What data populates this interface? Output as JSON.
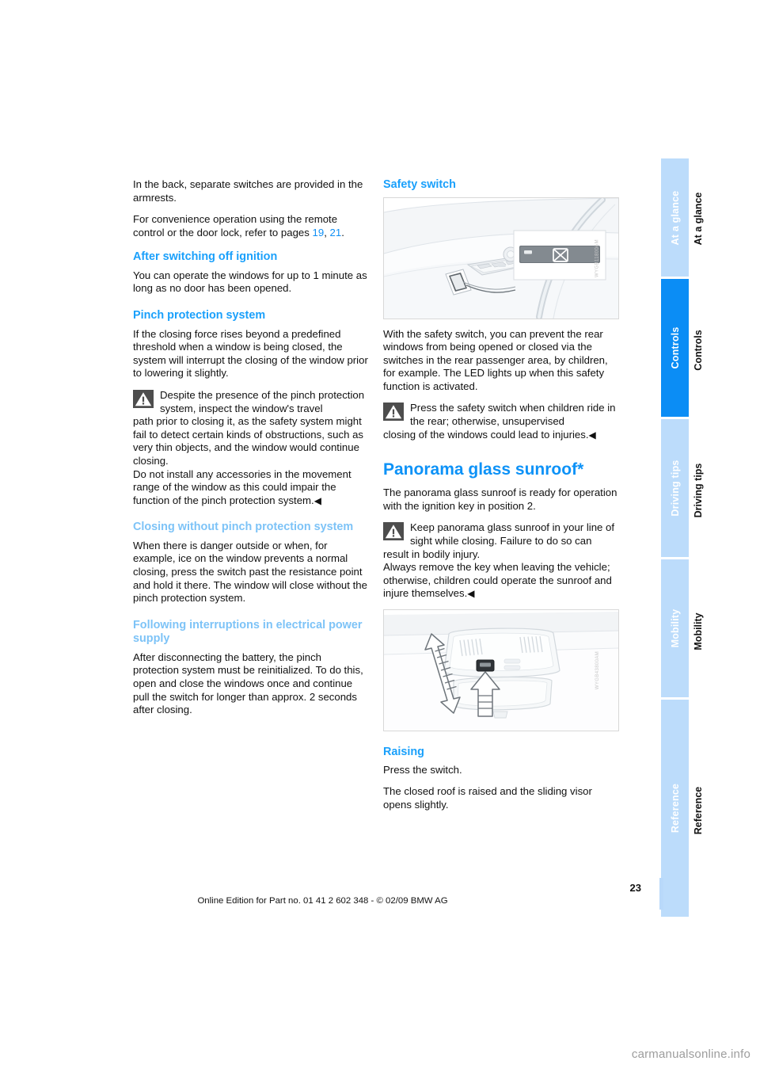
{
  "document": {
    "page_number": "23",
    "footer_note": "Online Edition for Part no. 01 41 2 602 348 - © 02/09 BMW AG",
    "watermark": "carmanualsonline.info",
    "accent_blue": "#1aa0fb",
    "accent_blue_pale": "#7dc3f7",
    "chapter_blue": "#0d92f7",
    "tab_active_color": "#0b8df5",
    "tab_inactive_color": "#bcdcfb"
  },
  "tabs": [
    {
      "label": "At a glance",
      "active": false
    },
    {
      "label": "Controls",
      "active": true
    },
    {
      "label": "Driving tips",
      "active": false
    },
    {
      "label": "Mobility",
      "active": false
    },
    {
      "label": "Reference",
      "active": false
    }
  ],
  "left_column": {
    "intro_paragraph_1": "In the back, separate switches are provided in the armrests.",
    "intro_paragraph_2_before": "For convenience operation using the remote control or the door lock, refer to pages ",
    "page_ref_1": "19",
    "page_ref_separator": ", ",
    "page_ref_2": "21",
    "page_ref_end": ".",
    "section_after_ignition": {
      "heading": "After switching off ignition",
      "body": "You can operate the windows for up to 1 minute as long as no door has been opened."
    },
    "section_pinch": {
      "heading": "Pinch protection system",
      "body": "If the closing force rises beyond a predefined threshold when a window is being closed, the system will interrupt the closing of the window prior to lowering it slightly.",
      "warning_lead": "Despite the presence of the pinch protection system, inspect the window's travel",
      "warning_rest": "path prior to closing it, as the safety system might fail to detect certain kinds of obstructions, such as very thin objects, and the window would continue closing.",
      "warning_rest_2": "Do not install any accessories in the movement range of the window as this could impair the function of the pinch protection system.",
      "end_mark": "◀"
    },
    "section_closing_without": {
      "heading": "Closing without pinch protection system",
      "body": "When there is danger outside or when, for example, ice on the window prevents a normal closing, press the switch past the resistance point and hold it there. The window will close without the pinch protection system."
    },
    "section_following_interruptions": {
      "heading": "Following interruptions in electrical power supply",
      "body": "After disconnecting the battery, the pinch protection system must be reinitialized. To do this, open and close the windows once and continue pull the switch for longer than approx. 2 seconds after closing."
    }
  },
  "right_column": {
    "section_safety_switch": {
      "heading": "Safety switch",
      "figure": {
        "name": "door-panel-window-switches-illustration",
        "reference_code": "WYGB11800AM",
        "callout_icon": "rear-window-lockout-icon"
      },
      "body": "With the safety switch, you can prevent the rear windows from being opened or closed via the switches in the rear passenger area, by children, for example. The LED lights up when this safety function is activated.",
      "warning_lead": "Press the safety switch when children ride in the rear; otherwise, unsupervised",
      "warning_rest": "closing of the windows could lead to injuries.",
      "end_mark": "◀"
    },
    "chapter_panorama": {
      "heading": "Panorama glass sunroof*",
      "body": "The panorama glass sunroof is ready for operation with the ignition key in position 2.",
      "warning_lead": "Keep panorama glass sunroof in your line of sight while closing. Failure to do so can",
      "warning_rest": "result in bodily injury.",
      "warning_rest_2": "Always remove the key when leaving the vehicle; otherwise, children could operate the sunroof and injure themselves.",
      "end_mark": "◀",
      "figure": {
        "name": "overhead-console-sunroof-switch-illustration",
        "reference_code": "WYGB43800AM"
      }
    },
    "section_raising": {
      "heading": "Raising",
      "body_1": "Press the switch.",
      "body_2": "The closed roof is raised and the sliding visor opens slightly."
    }
  }
}
